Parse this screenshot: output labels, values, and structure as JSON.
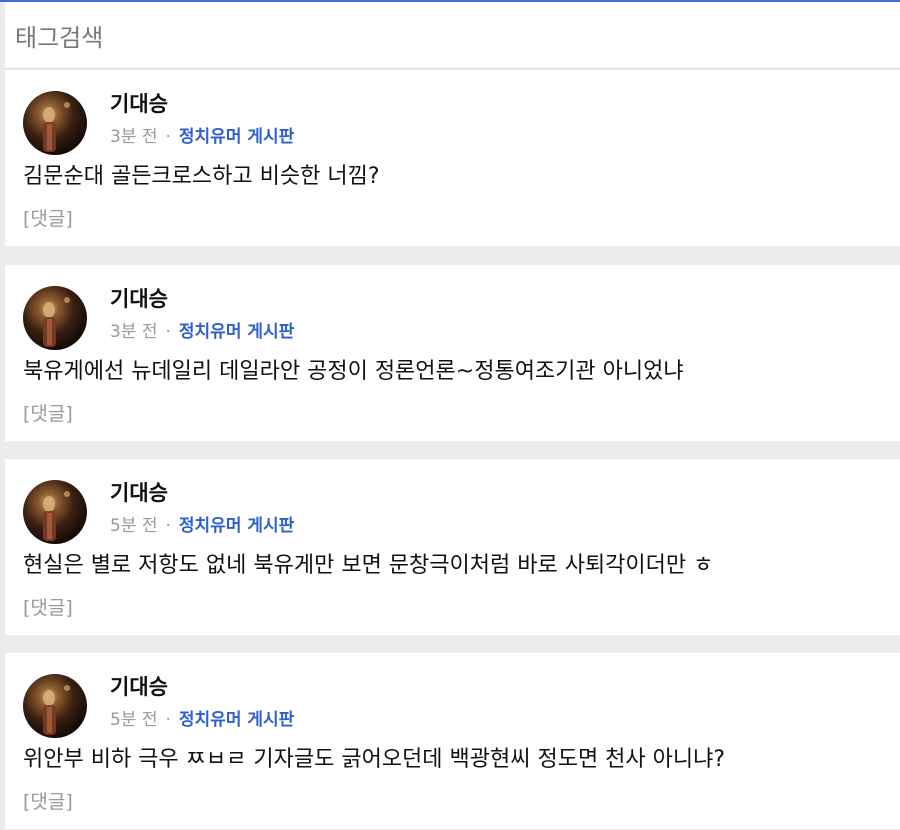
{
  "header": {
    "title": "태그검색"
  },
  "colors": {
    "accent": "#3f6bd6",
    "board_link": "#2f5fcf",
    "background": "#ececec"
  },
  "posts": [
    {
      "author": "기대승",
      "time": "3분 전",
      "separator": "·",
      "board": "정치유머 게시판",
      "content": "김문순대 골든크로스하고 비슷한 너낌?",
      "comment_link": "[댓글]"
    },
    {
      "author": "기대승",
      "time": "3분 전",
      "separator": "·",
      "board": "정치유머 게시판",
      "content": "북유게에선 뉴데일리 데일라안 공정이 정론언론~정통여조기관 아니었냐",
      "comment_link": "[댓글]"
    },
    {
      "author": "기대승",
      "time": "5분 전",
      "separator": "·",
      "board": "정치유머 게시판",
      "content": "현실은 별로 저항도 없네 북유게만 보면 문창극이처럼 바로 사퇴각이더만 ㅎ",
      "comment_link": "[댓글]"
    },
    {
      "author": "기대승",
      "time": "5분 전",
      "separator": "·",
      "board": "정치유머 게시판",
      "content": "위안부 비하 극우 ㅉㅂㄹ 기자글도 긁어오던데 백광현씨 정도면 천사 아니냐?",
      "comment_link": "[댓글]"
    }
  ]
}
